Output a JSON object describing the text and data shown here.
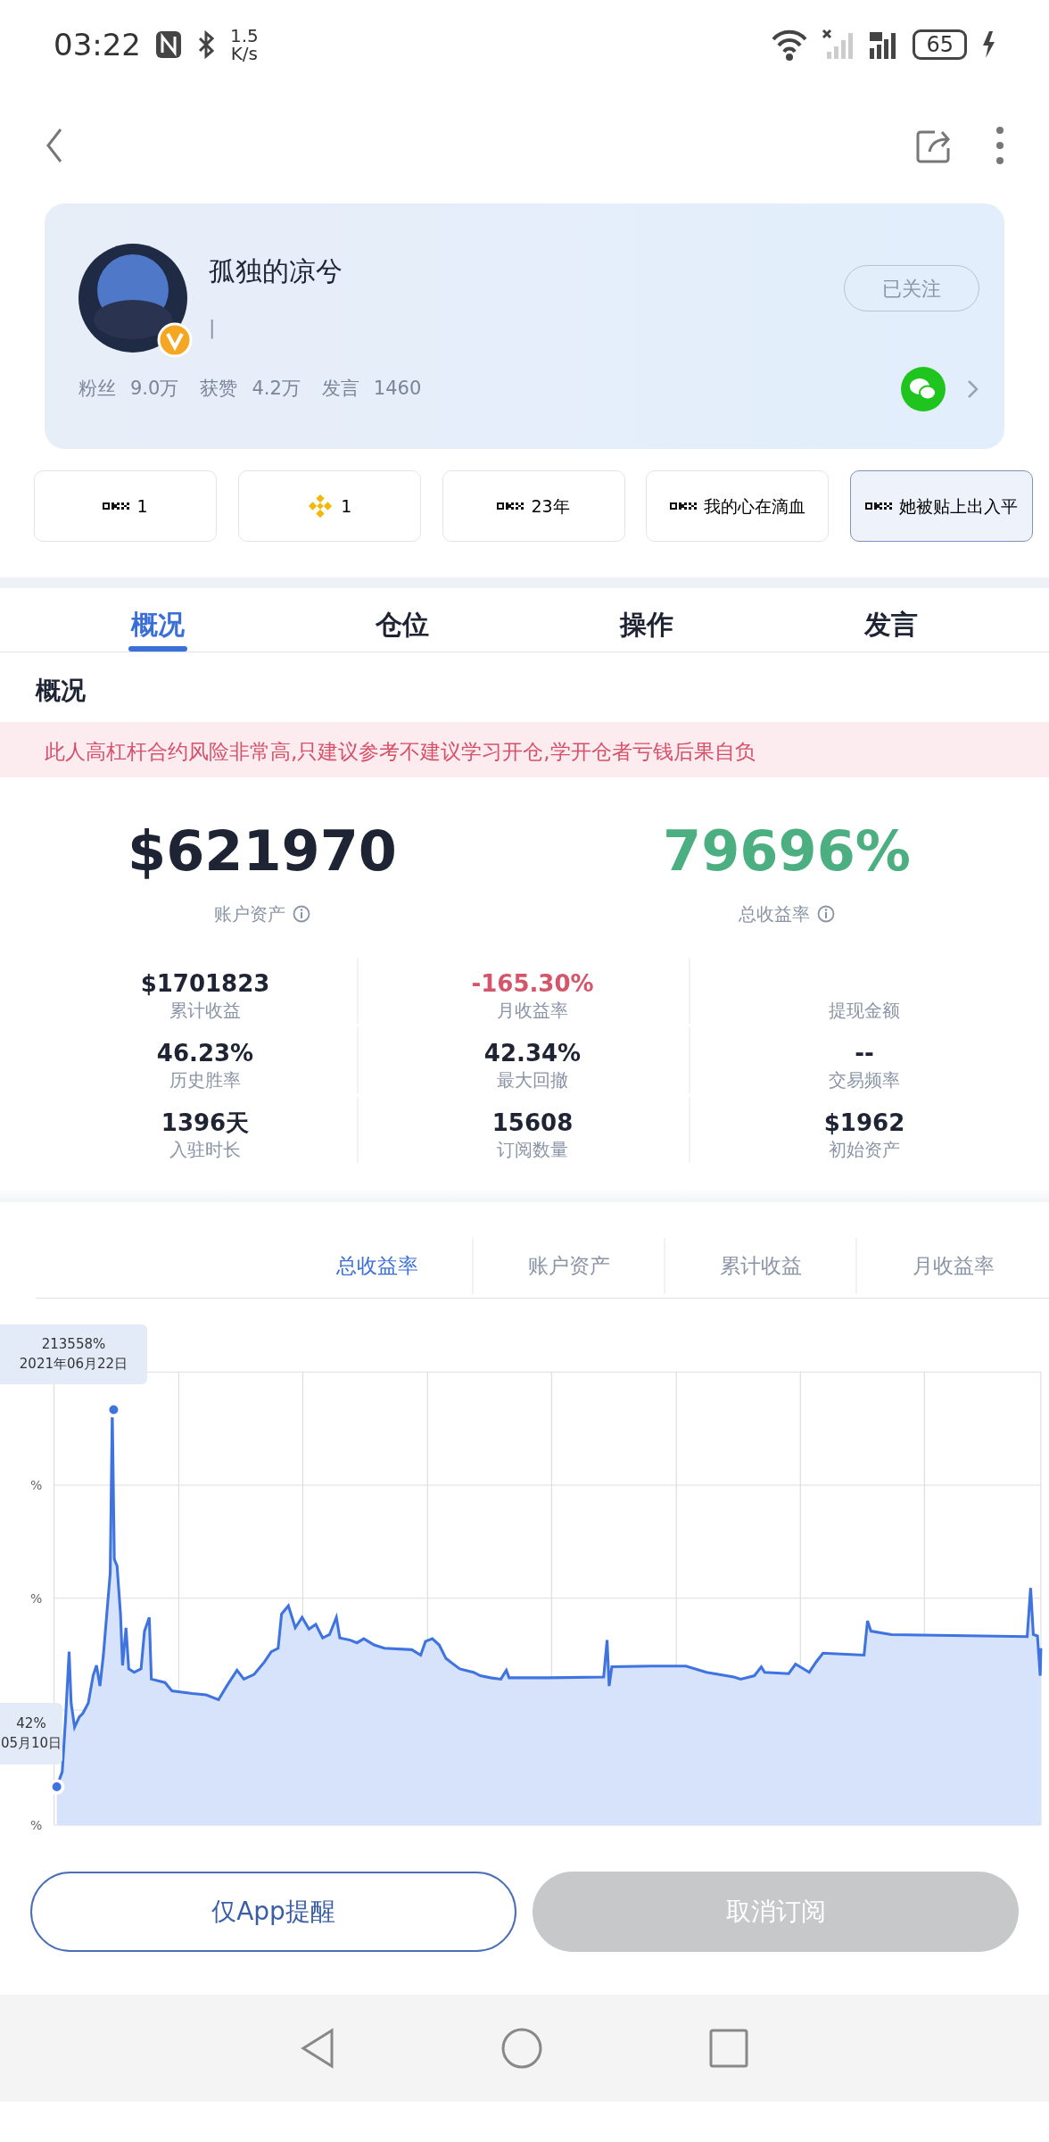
{
  "status_bar": {
    "time": "03:22",
    "speed_value": "1.5",
    "speed_unit": "K/s",
    "battery": "65"
  },
  "profile": {
    "name": "孤独的凉兮",
    "signature": "|",
    "follow_button": "已关注",
    "stats": [
      {
        "label": "粉丝",
        "value": "9.0万"
      },
      {
        "label": "获赞",
        "value": "4.2万"
      },
      {
        "label": "发言",
        "value": "1460"
      }
    ]
  },
  "chips": [
    {
      "kind": "okx",
      "label": "1",
      "selected": false
    },
    {
      "kind": "binance",
      "label": "1",
      "selected": false
    },
    {
      "kind": "okx",
      "label": "23年",
      "selected": false
    },
    {
      "kind": "okx",
      "label": "我的心在滴血",
      "selected": false
    },
    {
      "kind": "okx",
      "label": "她被贴上出入平",
      "selected": true
    }
  ],
  "tabs": [
    {
      "label": "概况",
      "selected": true
    },
    {
      "label": "仓位",
      "selected": false
    },
    {
      "label": "操作",
      "selected": false
    },
    {
      "label": "发言",
      "selected": false
    }
  ],
  "section_title": "概况",
  "warning": "此人高杠杆合约风险非常高,只建议参考不建议学习开仓,学开仓者亏钱后果自负",
  "headline": [
    {
      "value": "$621970",
      "label": "账户资产",
      "color": "#1e2433"
    },
    {
      "value": "79696%",
      "label": "总收益率",
      "color": "#4caf82"
    }
  ],
  "metrics": [
    [
      {
        "value": "$1701823",
        "label": "累计收益",
        "color": "#1e2433"
      },
      {
        "value": "-165.30%",
        "label": "月收益率",
        "color": "#d5566a"
      },
      {
        "label": "提现金额"
      }
    ],
    [
      {
        "value": "46.23%",
        "label": "历史胜率",
        "color": "#1e2433"
      },
      {
        "value": "42.34%",
        "label": "最大回撤",
        "color": "#1e2433"
      },
      {
        "value": "--",
        "label": "交易频率",
        "color": "#1e2433"
      }
    ],
    [
      {
        "value": "1396天",
        "label": "入驻时长",
        "color": "#1e2433"
      },
      {
        "value": "15608",
        "label": "订阅数量",
        "color": "#1e2433"
      },
      {
        "value": "$1962",
        "label": "初始资产",
        "color": "#1e2433"
      }
    ]
  ],
  "chart_tabs": [
    {
      "label": "总收益率",
      "selected": true
    },
    {
      "label": "账户资产",
      "selected": false
    },
    {
      "label": "累计收益",
      "selected": false
    },
    {
      "label": "月收益率",
      "selected": false
    }
  ],
  "chart": {
    "y_tick_labels": [
      "%",
      "%",
      "%"
    ],
    "tooltips": [
      {
        "value": "213558%",
        "date": "2021年06月22日"
      },
      {
        "value": "42%",
        "date": "05月10日"
      }
    ]
  },
  "buttons": [
    {
      "label": "仅App提醒",
      "disabled": false
    },
    {
      "label": "取消订阅",
      "disabled": true
    }
  ]
}
